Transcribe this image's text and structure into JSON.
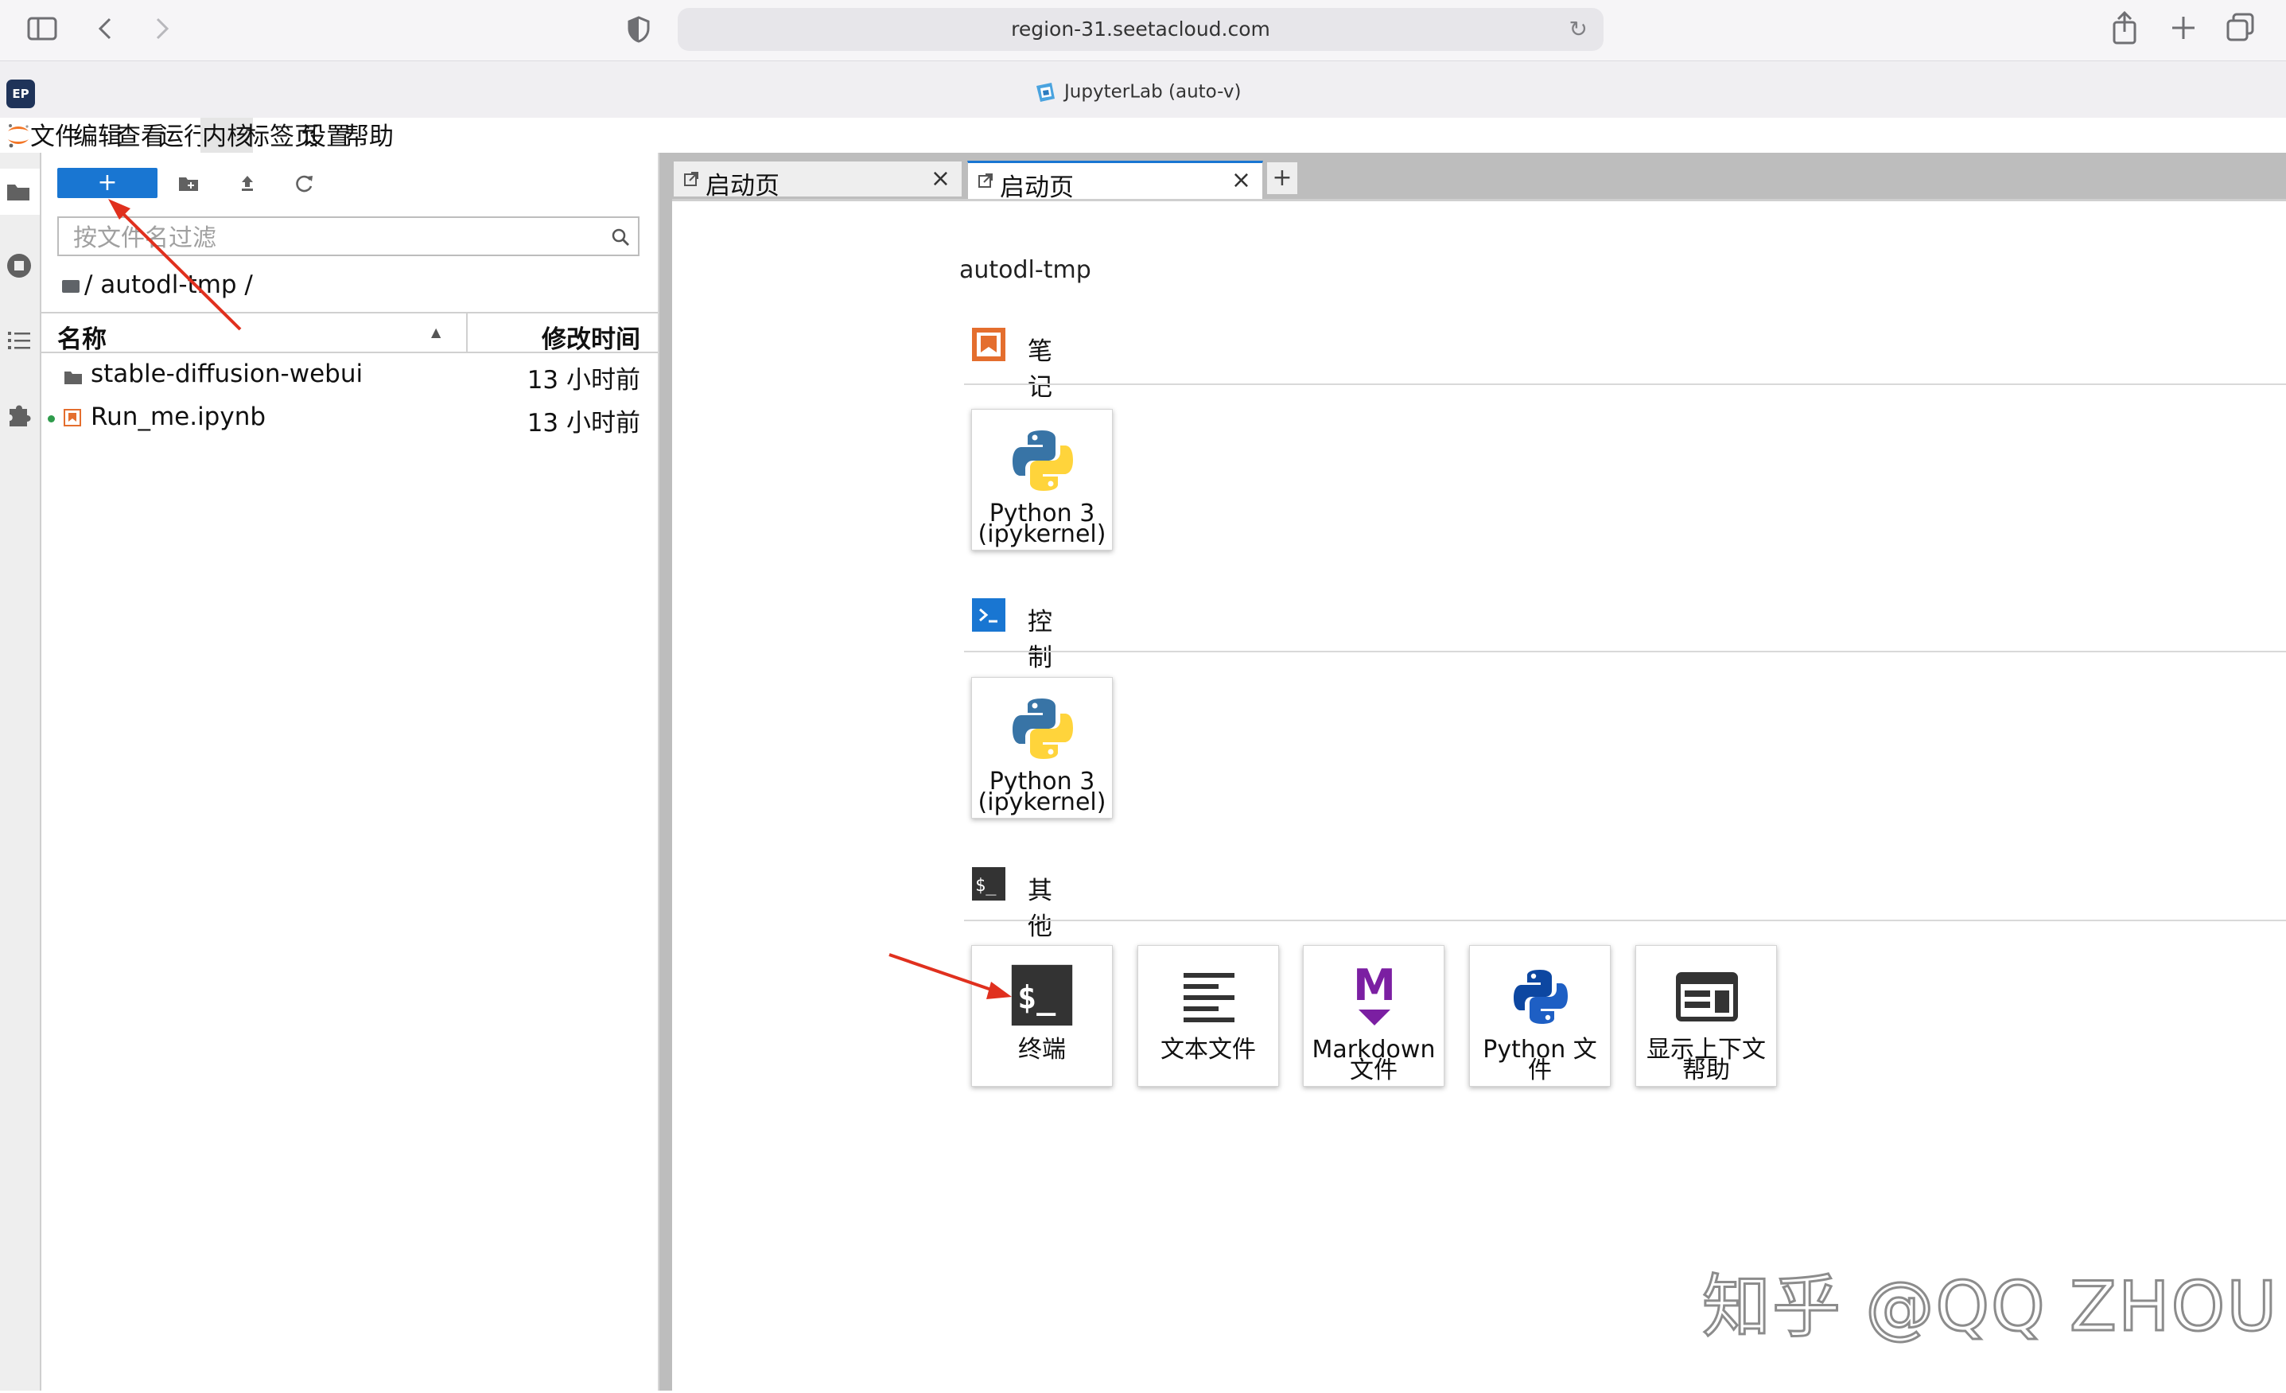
{
  "browser": {
    "url": "region-31.seetacloud.com",
    "tab_title": "JupyterLab (auto-v)",
    "favicon_text": "EP"
  },
  "menu": {
    "items": [
      "文件",
      "编辑",
      "查看",
      "运行",
      "内核",
      "标签页",
      "设置",
      "帮助"
    ],
    "active": "内核"
  },
  "file_browser": {
    "new_label": "+",
    "filter_placeholder": "按文件名过滤",
    "breadcrumb": "/ autodl-tmp /",
    "columns": {
      "name": "名称",
      "modified": "修改时间"
    },
    "files": [
      {
        "name": "stable-diffusion-webui",
        "type": "folder",
        "modified": "13 小时前",
        "running": false
      },
      {
        "name": "Run_me.ipynb",
        "type": "notebook",
        "modified": "13 小时前",
        "running": true
      }
    ]
  },
  "dock": {
    "tabs": [
      {
        "label": "启动页",
        "close": "×",
        "current": false
      },
      {
        "label": "启动页",
        "close": "×",
        "current": true
      }
    ],
    "add_tab": "+"
  },
  "launcher": {
    "cwd": "autodl-tmp",
    "sections": [
      {
        "title": "笔记本",
        "icon": "notebook-icon",
        "cards": [
          {
            "label": "Python 3 (ipykernel)",
            "icon": "python-logo-icon"
          }
        ]
      },
      {
        "title": "控制台",
        "icon": "console-icon",
        "cards": [
          {
            "label": "Python 3 (ipykernel)",
            "icon": "python-logo-icon"
          }
        ]
      },
      {
        "title": "其他",
        "icon": "other-terminal-icon",
        "cards": [
          {
            "label": "终端",
            "icon": "terminal-icon"
          },
          {
            "label": "文本文件",
            "icon": "text-file-icon"
          },
          {
            "label": "Markdown 文件",
            "icon": "markdown-icon"
          },
          {
            "label": "Python 文件",
            "icon": "python-file-icon"
          },
          {
            "label": "显示上下文帮助",
            "icon": "context-help-icon"
          }
        ]
      }
    ]
  },
  "colors": {
    "accent": "#1976d2",
    "notebook": "#e46e2e",
    "console": "#1976d2",
    "markdown": "#7b1fa2",
    "annotation_arrow": "#e0301e"
  },
  "watermark": "知乎 @QQ ZHOU"
}
